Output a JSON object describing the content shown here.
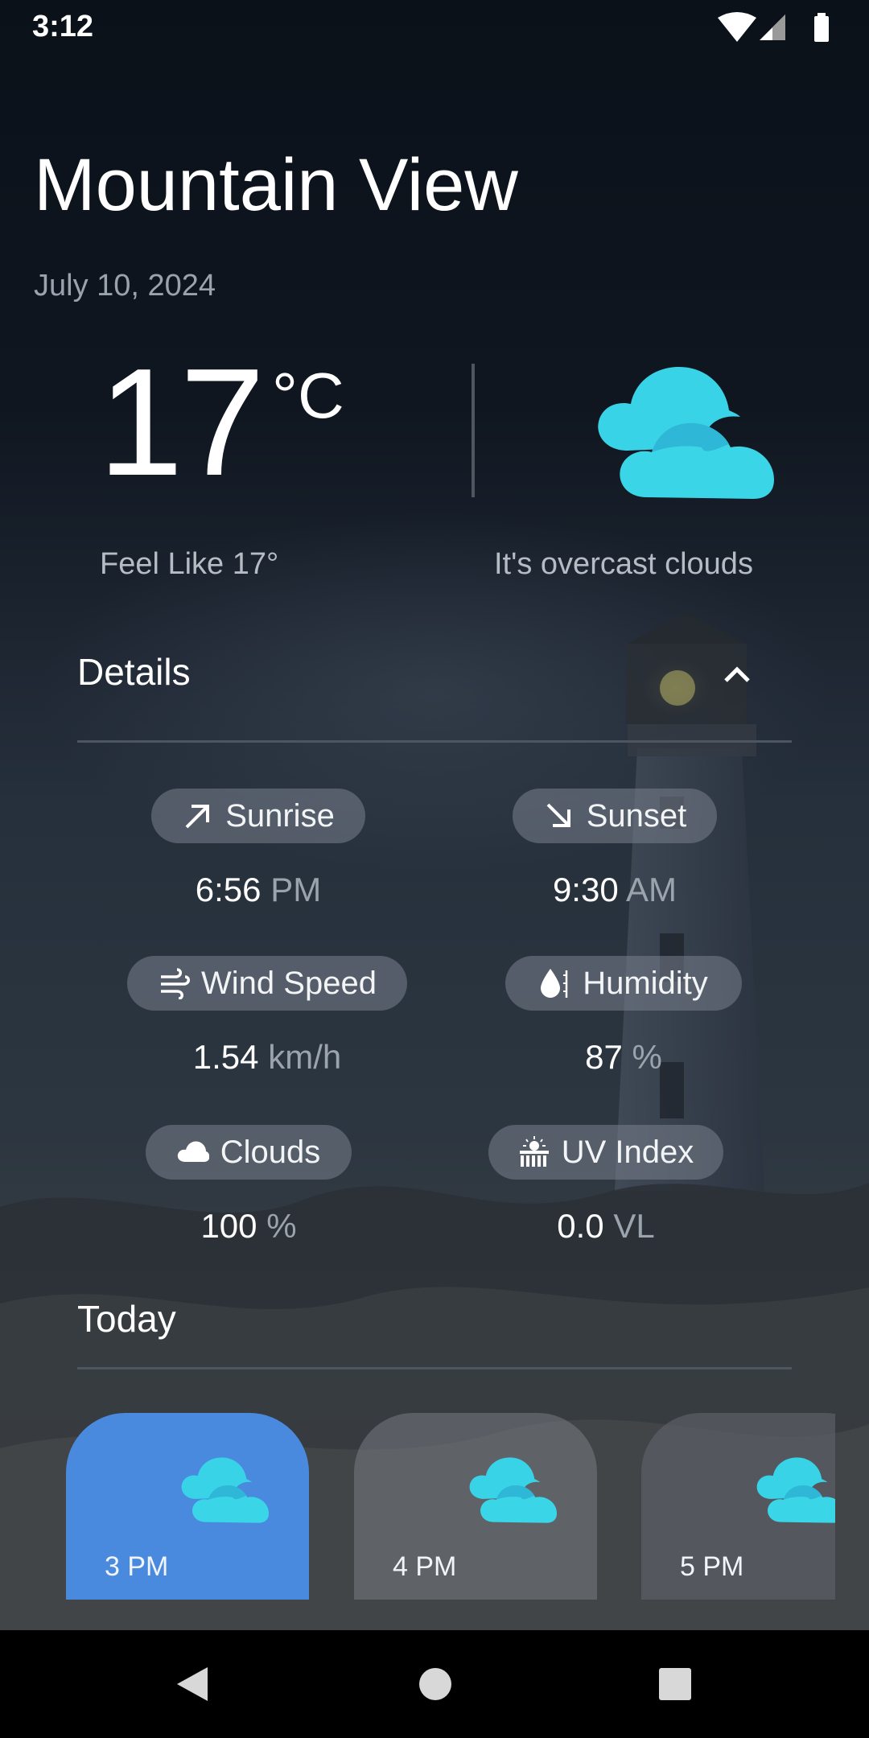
{
  "status_bar": {
    "time": "3:12",
    "icons": [
      "wifi-icon",
      "cellular-signal-icon",
      "battery-icon"
    ]
  },
  "header": {
    "city": "Mountain View",
    "date": "July 10, 2024"
  },
  "current": {
    "temperature": "17",
    "unit": "°C",
    "feels_like": "Feel Like 17°",
    "description": "It's overcast clouds",
    "icon": "overcast-cloud-icon",
    "icon_colors": [
      "#38d3e6",
      "#2fb8d8"
    ]
  },
  "details": {
    "title": "Details",
    "toggle_icon": "chevron-up-icon",
    "items": [
      {
        "label": "Sunrise",
        "icon": "arrow-up-right-icon",
        "value": "6:56",
        "unit": "PM"
      },
      {
        "label": "Sunset",
        "icon": "arrow-down-right-icon",
        "value": "9:30",
        "unit": "AM"
      },
      {
        "label": "Wind Speed",
        "icon": "wind-icon",
        "value": "1.54",
        "unit": "km/h"
      },
      {
        "label": "Humidity",
        "icon": "humidity-drop-icon",
        "value": "87",
        "unit": "%"
      },
      {
        "label": "Clouds",
        "icon": "cloud-icon",
        "value": "100",
        "unit": "%"
      },
      {
        "label": "UV Index",
        "icon": "uv-index-icon",
        "value": "0.0",
        "unit": "VL"
      }
    ]
  },
  "today": {
    "title": "Today",
    "hours": [
      {
        "label": "3 PM",
        "selected": true,
        "icon": "overcast-cloud-icon"
      },
      {
        "label": "4 PM",
        "selected": false,
        "icon": "overcast-cloud-icon"
      },
      {
        "label": "5 PM",
        "selected": false,
        "icon": "overcast-cloud-icon"
      }
    ],
    "selected_color": "#4a8ade"
  },
  "nav_bar": {
    "buttons": [
      "back-icon",
      "home-icon",
      "recents-icon"
    ]
  }
}
